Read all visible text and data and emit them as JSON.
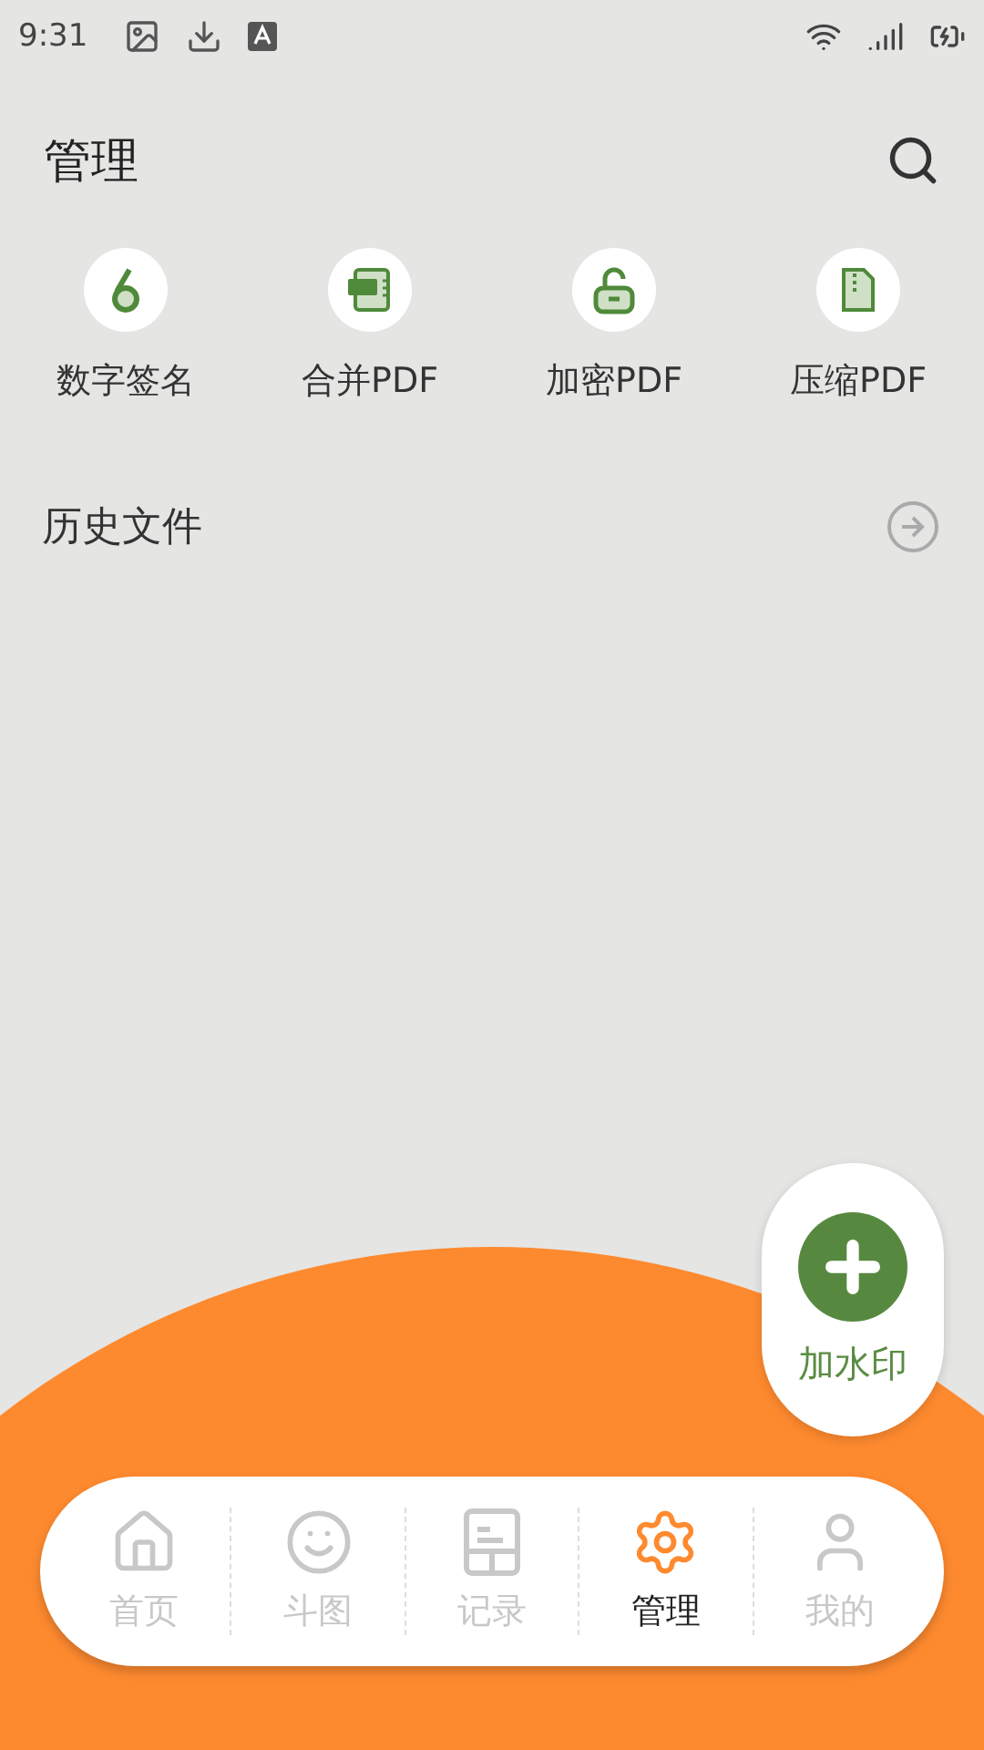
{
  "status_bar": {
    "time": "9:31"
  },
  "header": {
    "title": "管理"
  },
  "tools": [
    {
      "kind": "signature",
      "label": "数字签名"
    },
    {
      "kind": "merge",
      "label": "合并PDF"
    },
    {
      "kind": "encrypt",
      "label": "加密PDF"
    },
    {
      "kind": "compress",
      "label": "压缩PDF"
    }
  ],
  "history": {
    "label": "历史文件"
  },
  "fab": {
    "label": "加水印"
  },
  "tabs": [
    {
      "kind": "home",
      "label": "首页",
      "selected": false
    },
    {
      "kind": "smile",
      "label": "斗图",
      "selected": false
    },
    {
      "kind": "record",
      "label": "记录",
      "selected": false
    },
    {
      "kind": "manage",
      "label": "管理",
      "selected": true
    },
    {
      "kind": "me",
      "label": "我的",
      "selected": false
    }
  ]
}
